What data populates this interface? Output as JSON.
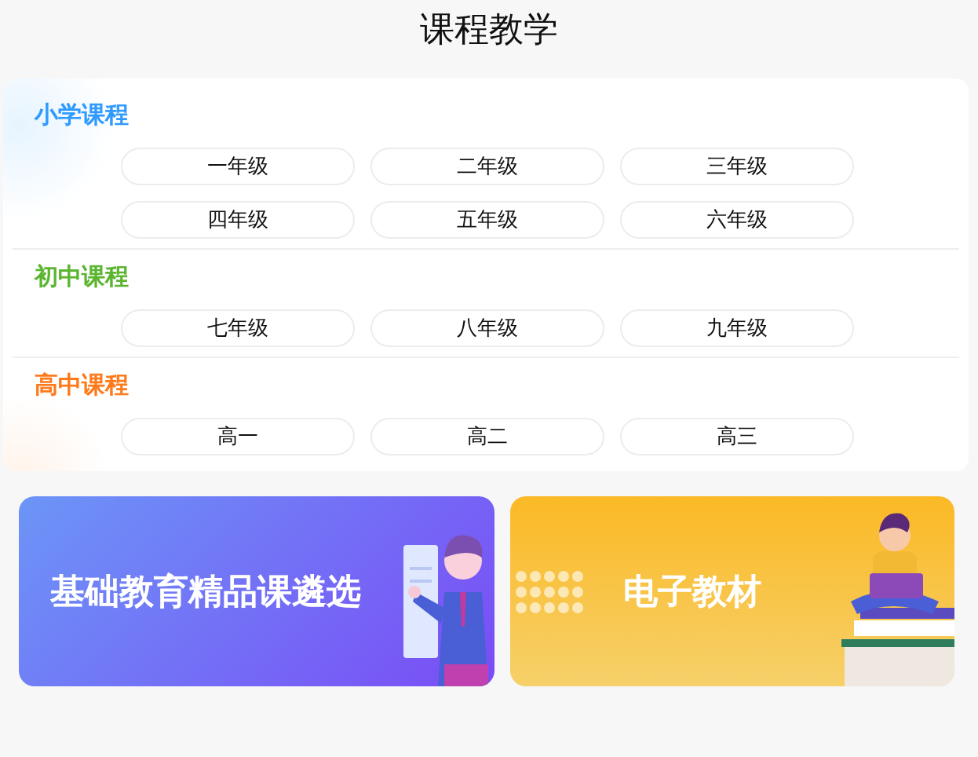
{
  "title": "课程教学",
  "sections": [
    {
      "name": "小学课程",
      "color": "#2f9bff",
      "grades": [
        "一年级",
        "二年级",
        "三年级",
        "四年级",
        "五年级",
        "六年级"
      ]
    },
    {
      "name": "初中课程",
      "color": "#5cb531",
      "grades": [
        "七年级",
        "八年级",
        "九年级"
      ]
    },
    {
      "name": "高中课程",
      "color": "#ff7a1a",
      "grades": [
        "高一",
        "高二",
        "高三"
      ]
    }
  ],
  "banners": [
    {
      "label": "基础教育精品课遴选",
      "kind": "teacher"
    },
    {
      "label": "电子教材",
      "kind": "reader"
    }
  ]
}
